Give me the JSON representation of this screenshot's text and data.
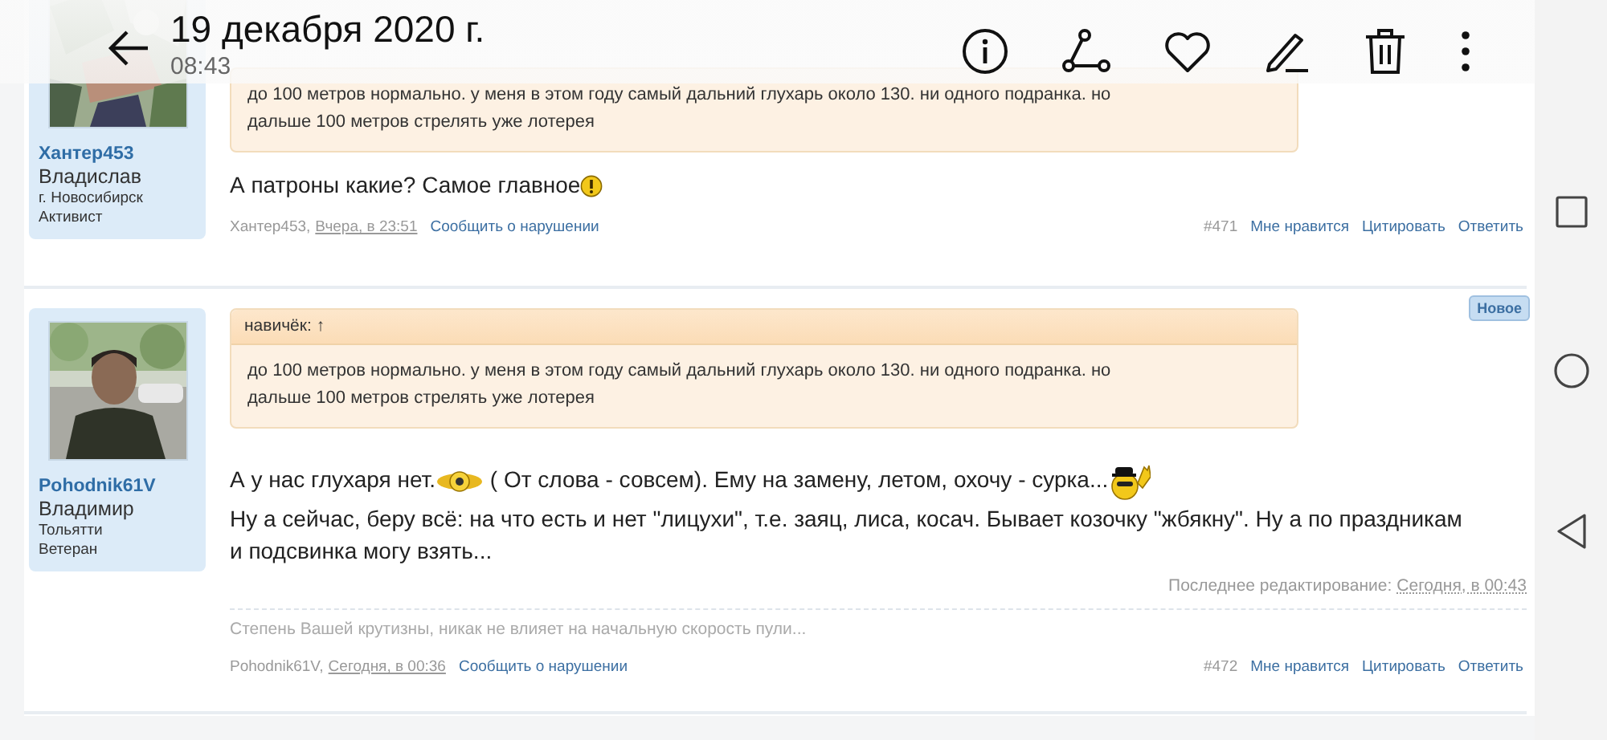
{
  "toolbar": {
    "title": "19 декабря 2020 г.",
    "time": "08:43"
  },
  "posts": [
    {
      "author": "Хантер453",
      "name": "Владислав",
      "city": "г. Новосибирск",
      "rank": "Активист",
      "avatar": {
        "kind": "picture"
      },
      "quote": {
        "lines": [
          "до 100 метров нормально. у меня в этом году самый дальний глухарь около 130. ни одного подранка. но",
          "дальше 100 метров стрелять уже лотерея"
        ]
      },
      "body": [
        {
          "kind": "text",
          "text": "А патроны какие? Самое главное"
        },
        {
          "kind": "emoticon"
        }
      ],
      "footer": {
        "author": "Хантер453,",
        "date": "Вчера, в 23:51",
        "report": "Сообщить о нарушении",
        "number": "#471",
        "actions": [
          "Мне нравится",
          "Цитировать",
          "Ответить"
        ]
      }
    },
    {
      "badge": "Новое",
      "author": "Pohodnik61V",
      "name": "Владимир",
      "city": "Тольятти",
      "rank": "Ветеран",
      "avatar": {
        "kind": "picture"
      },
      "quote": {
        "header": "навичёк: ↑",
        "lines": [
          "до 100 метров нормально. у меня в этом году самый дальний глухарь около 130. ни одного подранка. но",
          "дальше 100 метров стрелять уже лотерея"
        ]
      },
      "body": [
        {
          "kind": "text",
          "text": "А у нас глухаря нет."
        },
        {
          "kind": "emoticon"
        },
        {
          "kind": "text",
          "text": " ( От слова - совсем). Ему на замену, летом, охочу - сурка..."
        },
        {
          "kind": "emoticon"
        },
        {
          "kind": "break"
        },
        {
          "kind": "text",
          "text": "Ну а сейчас, беру всё: на что есть и нет \"лицухи\", т.е. заяц, лиса, косач. Бывает козочку \"жбякну\". Ну а по праздникам"
        },
        {
          "kind": "break"
        },
        {
          "kind": "text",
          "text": "и подсвинка могу взять..."
        }
      ],
      "edit": {
        "label": "Последнее редактирование:",
        "date": "Сегодня, в 00:43"
      },
      "signature": "Степень Вашей крутизны, никак не влияет на начальную скорость пули...",
      "footer": {
        "author": "Pohodnik61V,",
        "date": "Сегодня, в 00:36",
        "report": "Сообщить о нарушении",
        "number": "#472",
        "actions": [
          "Мне нравится",
          "Цитировать",
          "Ответить"
        ]
      }
    }
  ]
}
